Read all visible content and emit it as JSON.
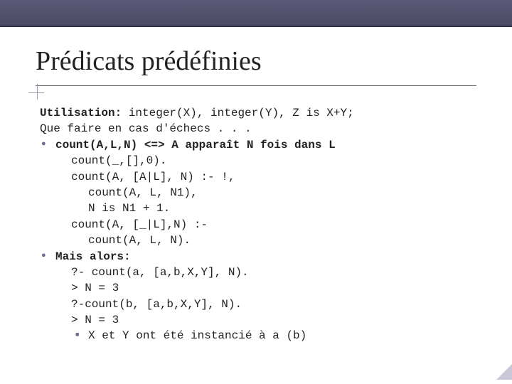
{
  "title": "Prédicats prédéfinies",
  "util_left": "Utilisation:",
  "util_right": " integer(X), integer(Y), Z is X+Y;",
  "fail_line": "Que faire en cas d'échecs . . .",
  "count_spec": "count(A,L,N) <=> A apparaît N fois dans L",
  "code1": "count(_,[],0).",
  "code2": "count(A, [A|L], N) :- !,",
  "code3": "count(A, L, N1),",
  "code4": "N is N1 + 1.",
  "code5": "count(A, [_|L],N) :-",
  "code6": "count(A, L, N).",
  "mais": "Mais alors:",
  "q1": "?- count(a, [a,b,X,Y], N).",
  "q2": "> N = 3",
  "q3": "?-count(b, [a,b,X,Y], N).",
  "q4": "> N = 3",
  "q5": "X et Y ont été instancié à a (b)"
}
